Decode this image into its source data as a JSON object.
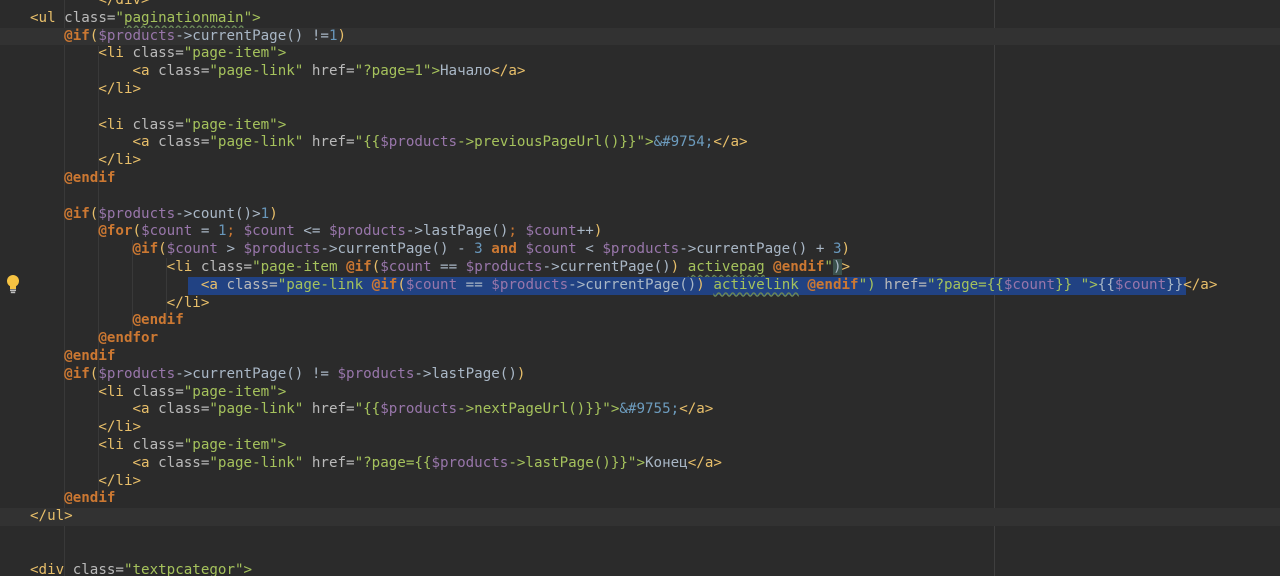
{
  "editor": {
    "lines": [
      {
        "segments": [
          {
            "t": "        ",
            "c": "plain"
          },
          {
            "t": "</div>",
            "c": "tag"
          }
        ]
      },
      {
        "segments": [
          {
            "t": "<ul ",
            "c": "tag"
          },
          {
            "t": "class=",
            "c": "attr"
          },
          {
            "t": "\"",
            "c": "str"
          },
          {
            "t": "paginationmain",
            "c": "str wavy"
          },
          {
            "t": "\">",
            "c": "str"
          }
        ]
      },
      {
        "segments": [
          {
            "t": "    ",
            "c": "plain"
          },
          {
            "t": "@if",
            "c": "kw"
          },
          {
            "t": "(",
            "c": "paren"
          },
          {
            "t": "$products",
            "c": "var"
          },
          {
            "t": "->currentPage() !=",
            "c": "plain"
          },
          {
            "t": "1",
            "c": "num"
          },
          {
            "t": ")",
            "c": "paren"
          }
        ],
        "current": true
      },
      {
        "segments": [
          {
            "t": "        ",
            "c": "plain"
          },
          {
            "t": "<li ",
            "c": "tag"
          },
          {
            "t": "class=",
            "c": "attr"
          },
          {
            "t": "\"page-item\">",
            "c": "str"
          }
        ]
      },
      {
        "segments": [
          {
            "t": "            ",
            "c": "plain"
          },
          {
            "t": "<a ",
            "c": "tag"
          },
          {
            "t": "class=",
            "c": "attr"
          },
          {
            "t": "\"page-link\" ",
            "c": "str"
          },
          {
            "t": "href=",
            "c": "attr"
          },
          {
            "t": "\"?page=1\">",
            "c": "str"
          },
          {
            "t": "Начало",
            "c": "plain"
          },
          {
            "t": "</a>",
            "c": "tag"
          }
        ]
      },
      {
        "segments": [
          {
            "t": "        ",
            "c": "plain"
          },
          {
            "t": "</li>",
            "c": "tag"
          }
        ]
      },
      {
        "segments": []
      },
      {
        "segments": [
          {
            "t": "        ",
            "c": "plain"
          },
          {
            "t": "<li ",
            "c": "tag"
          },
          {
            "t": "class=",
            "c": "attr"
          },
          {
            "t": "\"page-item\">",
            "c": "str"
          }
        ]
      },
      {
        "segments": [
          {
            "t": "            ",
            "c": "plain"
          },
          {
            "t": "<a ",
            "c": "tag"
          },
          {
            "t": "class=",
            "c": "attr"
          },
          {
            "t": "\"page-link\" ",
            "c": "str"
          },
          {
            "t": "href=",
            "c": "attr"
          },
          {
            "t": "\"{{",
            "c": "str"
          },
          {
            "t": "$products",
            "c": "var"
          },
          {
            "t": "->previousPageUrl()}}\">",
            "c": "str"
          },
          {
            "t": "&#9754;",
            "c": "ent"
          },
          {
            "t": "</a>",
            "c": "tag"
          }
        ]
      },
      {
        "segments": [
          {
            "t": "        ",
            "c": "plain"
          },
          {
            "t": "</li>",
            "c": "tag"
          }
        ]
      },
      {
        "segments": [
          {
            "t": "    ",
            "c": "plain"
          },
          {
            "t": "@endif",
            "c": "kw"
          }
        ]
      },
      {
        "segments": []
      },
      {
        "segments": [
          {
            "t": "    ",
            "c": "plain"
          },
          {
            "t": "@if",
            "c": "kw"
          },
          {
            "t": "(",
            "c": "paren"
          },
          {
            "t": "$products",
            "c": "var"
          },
          {
            "t": "->count()>",
            "c": "plain"
          },
          {
            "t": "1",
            "c": "num"
          },
          {
            "t": ")",
            "c": "paren"
          }
        ]
      },
      {
        "segments": [
          {
            "t": "        ",
            "c": "plain"
          },
          {
            "t": "@for",
            "c": "kw"
          },
          {
            "t": "(",
            "c": "paren"
          },
          {
            "t": "$count",
            "c": "var"
          },
          {
            "t": " = ",
            "c": "plain"
          },
          {
            "t": "1",
            "c": "num"
          },
          {
            "t": "; ",
            "c": "punc"
          },
          {
            "t": "$count",
            "c": "var"
          },
          {
            "t": " <= ",
            "c": "plain"
          },
          {
            "t": "$products",
            "c": "var"
          },
          {
            "t": "->lastPage()",
            "c": "plain"
          },
          {
            "t": "; ",
            "c": "punc"
          },
          {
            "t": "$count",
            "c": "var"
          },
          {
            "t": "++",
            "c": "plain"
          },
          {
            "t": ")",
            "c": "paren"
          }
        ]
      },
      {
        "segments": [
          {
            "t": "            ",
            "c": "plain"
          },
          {
            "t": "@if",
            "c": "kw"
          },
          {
            "t": "(",
            "c": "paren"
          },
          {
            "t": "$count",
            "c": "var"
          },
          {
            "t": " > ",
            "c": "plain"
          },
          {
            "t": "$products",
            "c": "var"
          },
          {
            "t": "->currentPage() - ",
            "c": "plain"
          },
          {
            "t": "3",
            "c": "num"
          },
          {
            "t": " ",
            "c": "plain"
          },
          {
            "t": "and",
            "c": "kw"
          },
          {
            "t": " ",
            "c": "plain"
          },
          {
            "t": "$count",
            "c": "var"
          },
          {
            "t": " < ",
            "c": "plain"
          },
          {
            "t": "$products",
            "c": "var"
          },
          {
            "t": "->currentPage() + ",
            "c": "plain"
          },
          {
            "t": "3",
            "c": "num"
          },
          {
            "t": ")",
            "c": "paren"
          }
        ]
      },
      {
        "segments": [
          {
            "t": "                ",
            "c": "plain"
          },
          {
            "t": "<li ",
            "c": "tag"
          },
          {
            "t": "class=",
            "c": "attr"
          },
          {
            "t": "\"page-item ",
            "c": "str"
          },
          {
            "t": "@if",
            "c": "kw"
          },
          {
            "t": "(",
            "c": "paren"
          },
          {
            "t": "$count",
            "c": "var"
          },
          {
            "t": " == ",
            "c": "plain"
          },
          {
            "t": "$products",
            "c": "var"
          },
          {
            "t": "->currentPage()",
            "c": "plain"
          },
          {
            "t": ")",
            "c": "paren"
          },
          {
            "t": " ",
            "c": "str"
          },
          {
            "t": "activepag",
            "c": "str wavy"
          },
          {
            "t": " ",
            "c": "str"
          },
          {
            "t": "@endif",
            "c": "kw"
          },
          {
            "t": "\"",
            "c": "str"
          },
          {
            "t": ")",
            "c": "plain brace-match"
          },
          {
            "t": ">",
            "c": "tag"
          }
        ]
      },
      {
        "segments": [
          {
            "t": "                    ",
            "c": "plain"
          },
          {
            "t": "<a ",
            "c": "tag"
          },
          {
            "t": "class=",
            "c": "attr"
          },
          {
            "t": "\"page-link ",
            "c": "str"
          },
          {
            "t": "@if",
            "c": "kw"
          },
          {
            "t": "(",
            "c": "paren"
          },
          {
            "t": "$count",
            "c": "var"
          },
          {
            "t": " == ",
            "c": "plain"
          },
          {
            "t": "$products",
            "c": "var"
          },
          {
            "t": "->currentPage()",
            "c": "plain"
          },
          {
            "t": ")",
            "c": "paren"
          },
          {
            "t": " ",
            "c": "str"
          },
          {
            "t": "activelink",
            "c": "str wavy"
          },
          {
            "t": " ",
            "c": "str"
          },
          {
            "t": "@endif",
            "c": "kw"
          },
          {
            "t": "\") ",
            "c": "str"
          },
          {
            "t": "href=",
            "c": "attr"
          },
          {
            "t": "\"?page={{",
            "c": "str"
          },
          {
            "t": "$count",
            "c": "var"
          },
          {
            "t": "}} \">",
            "c": "str"
          },
          {
            "t": "{{",
            "c": "plain"
          },
          {
            "t": "$count",
            "c": "var"
          },
          {
            "t": "}}",
            "c": "plain"
          },
          {
            "t": "</a>",
            "c": "tag"
          }
        ],
        "selected": true
      },
      {
        "segments": [
          {
            "t": "                ",
            "c": "plain"
          },
          {
            "t": "</li>",
            "c": "tag"
          }
        ]
      },
      {
        "segments": [
          {
            "t": "            ",
            "c": "plain"
          },
          {
            "t": "@endif",
            "c": "kw"
          }
        ]
      },
      {
        "segments": [
          {
            "t": "        ",
            "c": "plain"
          },
          {
            "t": "@endfor",
            "c": "kw"
          }
        ]
      },
      {
        "segments": [
          {
            "t": "    ",
            "c": "plain"
          },
          {
            "t": "@endif",
            "c": "kw"
          }
        ]
      },
      {
        "segments": [
          {
            "t": "    ",
            "c": "plain"
          },
          {
            "t": "@if",
            "c": "kw"
          },
          {
            "t": "(",
            "c": "paren"
          },
          {
            "t": "$products",
            "c": "var"
          },
          {
            "t": "->currentPage() != ",
            "c": "plain"
          },
          {
            "t": "$products",
            "c": "var"
          },
          {
            "t": "->lastPage()",
            "c": "plain"
          },
          {
            "t": ")",
            "c": "paren"
          }
        ]
      },
      {
        "segments": [
          {
            "t": "        ",
            "c": "plain"
          },
          {
            "t": "<li ",
            "c": "tag"
          },
          {
            "t": "class=",
            "c": "attr"
          },
          {
            "t": "\"page-item\">",
            "c": "str"
          }
        ]
      },
      {
        "segments": [
          {
            "t": "            ",
            "c": "plain"
          },
          {
            "t": "<a ",
            "c": "tag"
          },
          {
            "t": "class=",
            "c": "attr"
          },
          {
            "t": "\"page-link\" ",
            "c": "str"
          },
          {
            "t": "href=",
            "c": "attr"
          },
          {
            "t": "\"{{",
            "c": "str"
          },
          {
            "t": "$products",
            "c": "var"
          },
          {
            "t": "->nextPageUrl()}}\">",
            "c": "str"
          },
          {
            "t": "&#9755;",
            "c": "ent"
          },
          {
            "t": "</a>",
            "c": "tag"
          }
        ]
      },
      {
        "segments": [
          {
            "t": "        ",
            "c": "plain"
          },
          {
            "t": "</li>",
            "c": "tag"
          }
        ]
      },
      {
        "segments": [
          {
            "t": "        ",
            "c": "plain"
          },
          {
            "t": "<li ",
            "c": "tag"
          },
          {
            "t": "class=",
            "c": "attr"
          },
          {
            "t": "\"page-item\">",
            "c": "str"
          }
        ]
      },
      {
        "segments": [
          {
            "t": "            ",
            "c": "plain"
          },
          {
            "t": "<a ",
            "c": "tag"
          },
          {
            "t": "class=",
            "c": "attr"
          },
          {
            "t": "\"page-link\" ",
            "c": "str"
          },
          {
            "t": "href=",
            "c": "attr"
          },
          {
            "t": "\"?page={{",
            "c": "str"
          },
          {
            "t": "$products",
            "c": "var"
          },
          {
            "t": "->lastPage()}}\">",
            "c": "str"
          },
          {
            "t": "Конец",
            "c": "plain"
          },
          {
            "t": "</a>",
            "c": "tag"
          }
        ]
      },
      {
        "segments": [
          {
            "t": "        ",
            "c": "plain"
          },
          {
            "t": "</li>",
            "c": "tag"
          }
        ]
      },
      {
        "segments": [
          {
            "t": "    ",
            "c": "plain"
          },
          {
            "t": "@endif",
            "c": "kw"
          }
        ]
      },
      {
        "segments": [
          {
            "t": "</ul>",
            "c": "tag"
          }
        ],
        "current": true
      },
      {
        "segments": []
      },
      {
        "segments": []
      },
      {
        "segments": [
          {
            "t": "<div ",
            "c": "tag"
          },
          {
            "t": "class=",
            "c": "attr"
          },
          {
            "t": "\"textpcategor\">",
            "c": "str"
          }
        ]
      }
    ]
  },
  "colors": {
    "background": "#2b2b2b",
    "selection": "#214283",
    "tag": "#e8bf6a",
    "string": "#a5c25c",
    "keyword": "#cc7832",
    "variable": "#9876aa",
    "number": "#6897bb"
  },
  "gutter": {
    "intention_icon": "lightbulb-icon"
  }
}
